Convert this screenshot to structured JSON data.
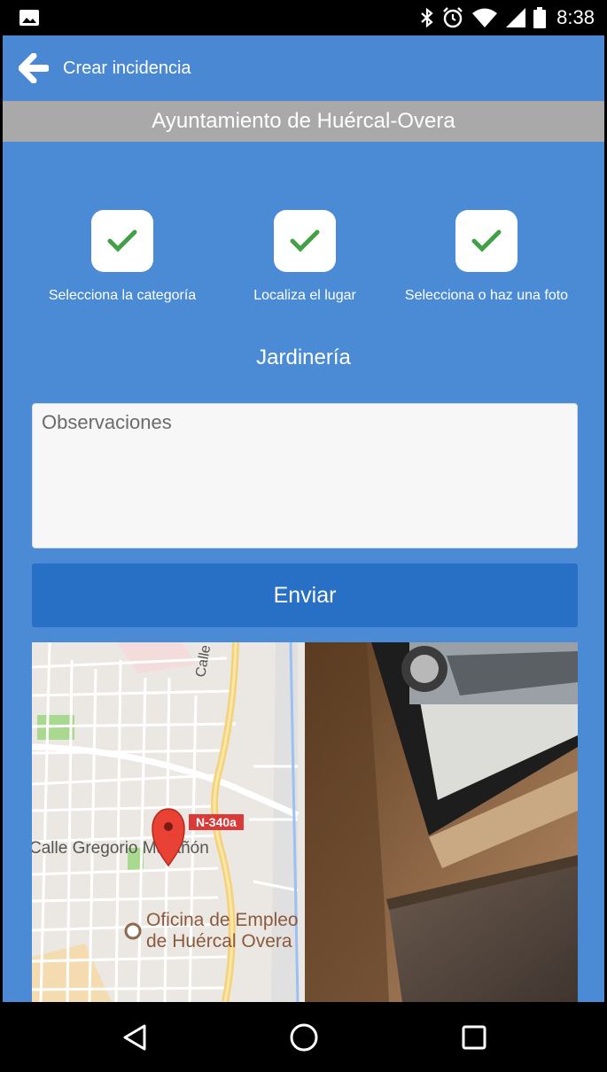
{
  "status_bar": {
    "time": "8:38",
    "icons": [
      "image-icon",
      "bluetooth-icon",
      "alarm-icon",
      "wifi-icon",
      "cell-signal-icon",
      "battery-icon"
    ]
  },
  "app_bar": {
    "title": "Crear incidencia",
    "back_icon": "arrow-left-icon"
  },
  "banner": {
    "text": "Ayuntamiento de Huércal-Overa",
    "color": "#a9a9a9"
  },
  "colors": {
    "primary": "#4b88d4",
    "button": "#2870c6",
    "check": "#43a047"
  },
  "steps": [
    {
      "label": "Selecciona la categoría",
      "done": true
    },
    {
      "label": "Localiza el lugar",
      "done": true
    },
    {
      "label": "Selecciona o haz una foto",
      "done": true
    }
  ],
  "category": "Jardinería",
  "observations": {
    "placeholder": "Observaciones",
    "value": ""
  },
  "submit_label": "Enviar",
  "map": {
    "street_label": "Calle Gregorio Marañón",
    "road_badge": "N-340a",
    "street_top": "Calle",
    "poi_line1": "Oficina de Empleo",
    "poi_line2": "de Huércal Overa"
  },
  "nav_bar": {
    "icons": [
      "back-triangle-icon",
      "home-circle-icon",
      "recents-square-icon"
    ]
  }
}
